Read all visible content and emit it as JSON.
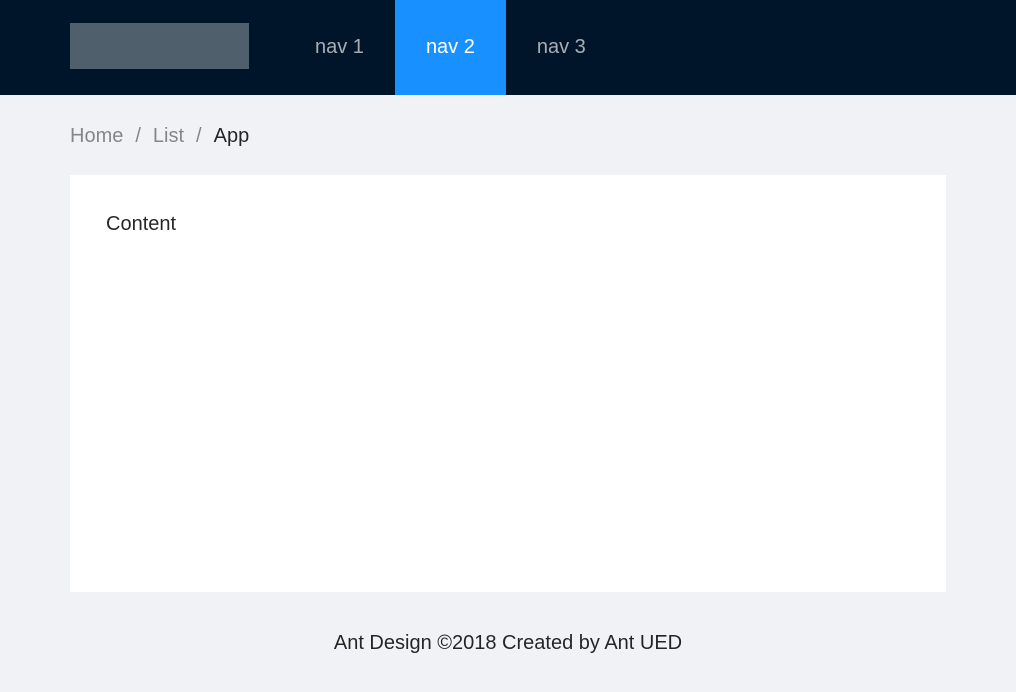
{
  "header": {
    "menu": [
      {
        "label": "nav 1",
        "active": false
      },
      {
        "label": "nav 2",
        "active": true
      },
      {
        "label": "nav 3",
        "active": false
      }
    ]
  },
  "breadcrumb": {
    "items": [
      "Home",
      "List",
      "App"
    ],
    "separator": "/"
  },
  "main": {
    "content_text": "Content"
  },
  "footer": {
    "text": "Ant Design ©2018 Created by Ant UED"
  },
  "colors": {
    "header_bg": "#001529",
    "accent": "#1890ff",
    "page_bg": "#f0f2f5",
    "logo_placeholder": "#4f5f6c"
  }
}
